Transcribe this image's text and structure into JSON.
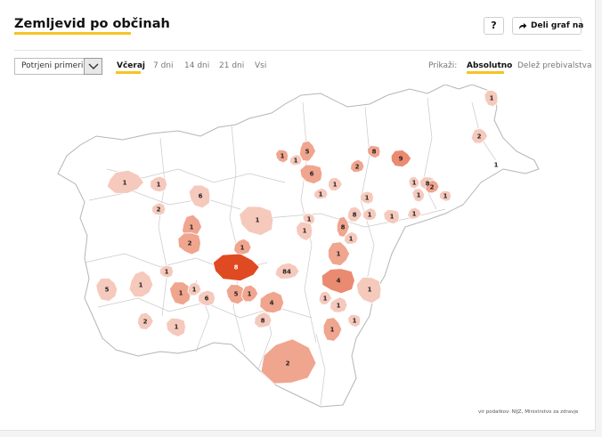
{
  "header": {
    "title": "Zemljevid po občinah",
    "help_label": "?",
    "share_label": "Deli graf na"
  },
  "filters": {
    "select_value": "Potrjeni primeri",
    "tabs": [
      "Včeraj",
      "7 dni",
      "14 dni",
      "21 dni",
      "Vsi"
    ],
    "active_tab": "Včeraj",
    "show_label": "Prikaži:",
    "modes": [
      "Absolutno",
      "Delež prebivalstva"
    ],
    "active_mode": "Absolutno"
  },
  "map": {
    "colors": {
      "empty": "#ffffff",
      "outline": "#b5b5b5",
      "level_1": "#f5c9bc",
      "level_2": "#f0a58f",
      "level_3": "#ea8a70",
      "level_4": "#e04a22"
    },
    "labels": [
      "1",
      "2",
      "1",
      "1",
      "5",
      "1",
      "6",
      "1",
      "1",
      "8",
      "9",
      "2",
      "8",
      "1",
      "2",
      "1",
      "1",
      "1",
      "1",
      "1",
      "1",
      "1",
      "6",
      "1",
      "2",
      "1",
      "8",
      "1",
      "1",
      "8",
      "1",
      "1",
      "1",
      "1",
      "2",
      "8",
      "84",
      "4",
      "5",
      "1",
      "1",
      "1",
      "1",
      "6",
      "5",
      "1",
      "4",
      "1",
      "1",
      "1",
      "1",
      "2",
      "8",
      "1",
      "1",
      "2"
    ]
  },
  "source": "vir podatkov: NIJZ, Ministrstvo za zdravje"
}
